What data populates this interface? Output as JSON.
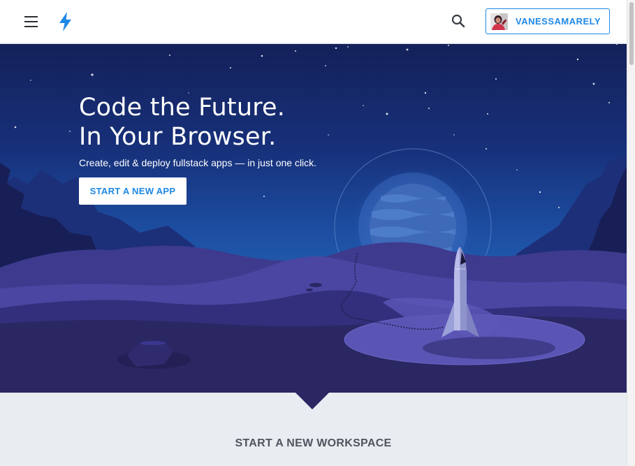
{
  "header": {
    "menu_icon": "hamburger-menu-icon",
    "logo_icon": "lightning-bolt-icon",
    "search_icon": "search-icon",
    "user": {
      "name": "VANESSAMARELY",
      "avatar": "user-avatar"
    }
  },
  "hero": {
    "title_line1": "Code the Future.",
    "title_line2": "In Your Browser.",
    "subtitle": "Create, edit & deploy fullstack apps — in just one click.",
    "cta_label": "START A NEW APP"
  },
  "section": {
    "title": "START A NEW WORKSPACE"
  },
  "colors": {
    "accent": "#1e88e5",
    "hero_dark": "#2a2763",
    "page_bg": "#e9ecf0"
  }
}
